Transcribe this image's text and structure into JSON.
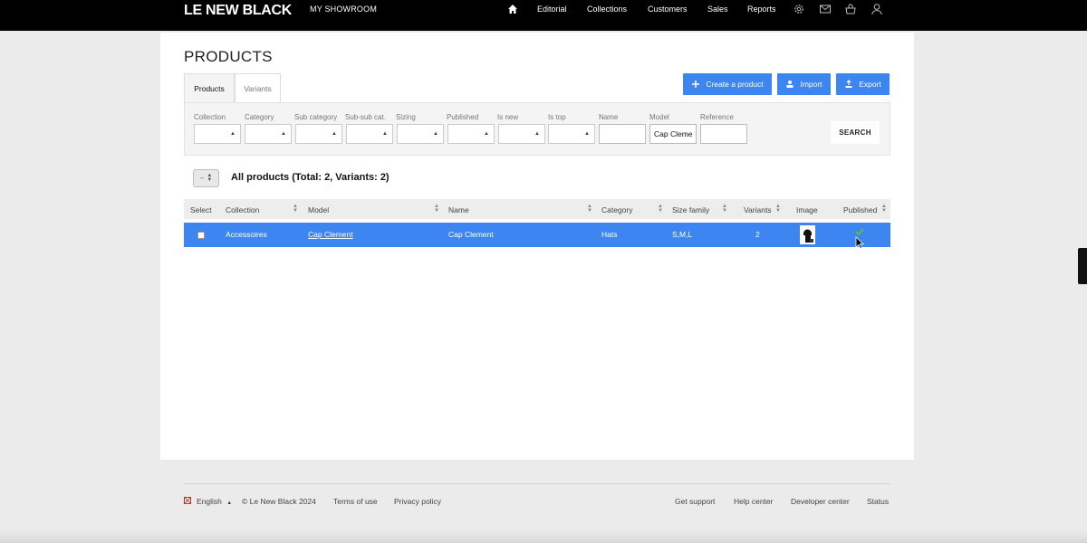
{
  "header": {
    "logo": "LE NEW BLACK",
    "section": "MY SHOWROOM",
    "nav": [
      "Editorial",
      "Collections",
      "Customers",
      "Sales",
      "Reports"
    ],
    "icons": [
      "home-icon",
      "settings-icon",
      "mail-icon",
      "basket-icon",
      "user-icon"
    ]
  },
  "page": {
    "title": "PRODUCTS",
    "tabs": [
      "Products",
      "Variants"
    ],
    "active_tab": "Products",
    "actions": {
      "create": "Create a product",
      "import": "Import",
      "export": "Export"
    }
  },
  "filters": {
    "labels": {
      "collection": "Collection",
      "category": "Category",
      "sub_category": "Sub category",
      "sub_sub_cat": "Sub-sub cat.",
      "sizing": "Sizing",
      "published": "Published",
      "is_new": "Is new",
      "is_top": "Is top",
      "name": "Name",
      "model": "Model",
      "reference": "Reference"
    },
    "values": {
      "name": "",
      "model": "Cap Cleme",
      "reference": ""
    },
    "search_label": "SEARCH"
  },
  "list": {
    "bulk_select": "--",
    "summary": "All products (Total: 2, Variants: 2)",
    "columns": {
      "select": "Select",
      "collection": "Collection",
      "model": "Model",
      "name": "Name",
      "category": "Category",
      "size_family": "Size family",
      "variants": "Variants",
      "image": "Image",
      "published": "Published"
    },
    "rows": [
      {
        "collection": "Accessoires",
        "model": "Cap Clement",
        "name": "Cap Clement",
        "category": "Hats",
        "size_family": "S,M,L",
        "variants": "2",
        "published": true,
        "selected": true
      }
    ]
  },
  "footer": {
    "language": "English",
    "copyright": "© Le New Black 2024",
    "terms": "Terms of use",
    "privacy": "Privacy policy",
    "support": "Get support",
    "help": "Help center",
    "developer": "Developer center",
    "status": "Status"
  },
  "colors": {
    "accent": "#3d86f2",
    "topbar": "#000000",
    "background": "#ebebeb"
  }
}
